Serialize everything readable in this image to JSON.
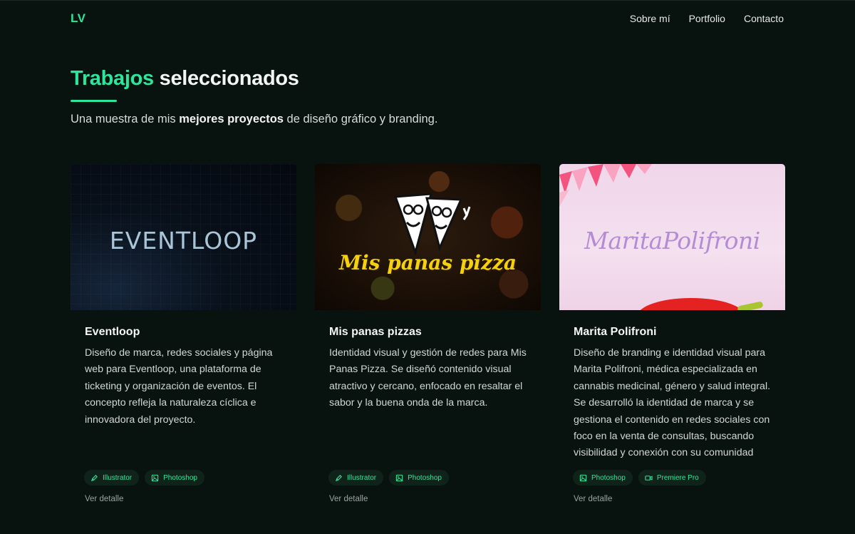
{
  "nav": {
    "logo": "LV",
    "links": [
      "Sobre mí",
      "Portfolio",
      "Contacto"
    ]
  },
  "hero": {
    "title_accent": "Trabajos",
    "title_rest": " seleccionados",
    "subtitle_pre": "Una muestra de mis ",
    "subtitle_bold": "mejores proyectos",
    "subtitle_post": " de diseño gráfico y branding."
  },
  "projects": [
    {
      "title": "Eventloop",
      "thumb_text": "EVENTLOOP",
      "description": "Diseño de marca, redes sociales y página web para Eventloop, una plataforma de ticketing y organización de eventos. El concepto refleja la naturaleza cíclica e innovadora del proyecto.",
      "tags": [
        {
          "label": "Illustrator",
          "icon": "pen-icon"
        },
        {
          "label": "Photoshop",
          "icon": "image-icon"
        }
      ],
      "link": "Ver detalle"
    },
    {
      "title": "Mis panas pizzas",
      "thumb_text": "Mis panas pizza",
      "description": "Identidad visual y gestión de redes para Mis Panas Pizza. Se diseñó contenido visual atractivo y cercano, enfocado en resaltar el sabor y la buena onda de la marca.",
      "tags": [
        {
          "label": "Illustrator",
          "icon": "pen-icon"
        },
        {
          "label": "Photoshop",
          "icon": "image-icon"
        }
      ],
      "link": "Ver detalle"
    },
    {
      "title": "Marita Polifroni",
      "thumb_text": "MaritaPolifroni",
      "description": "Diseño de branding e identidad visual para Marita Polifroni, médica especializada en cannabis medicinal, género y salud integral. Se desarrolló la identidad de marca y se gestiona el contenido en redes sociales con foco en la venta de consultas, buscando visibilidad y conexión con su comunidad",
      "tags": [
        {
          "label": "Photoshop",
          "icon": "image-icon"
        },
        {
          "label": "Premiere Pro",
          "icon": "video-icon"
        }
      ],
      "link": "Ver detalle"
    }
  ],
  "colors": {
    "background": "#08130f",
    "accent": "#2ee59d",
    "tag_bg": "#10231b"
  }
}
